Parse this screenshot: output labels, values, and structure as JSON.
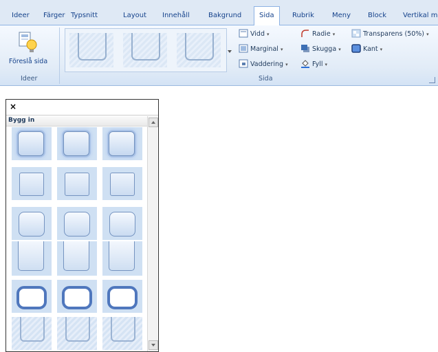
{
  "ribbon": {
    "tabs": [
      {
        "label": "Ideer"
      },
      {
        "label": "Färger"
      },
      {
        "label": "Typsnitt"
      },
      {
        "label": "Layout"
      },
      {
        "label": "Innehåll"
      },
      {
        "label": "Bakgrund"
      },
      {
        "label": "Sida",
        "active": true
      },
      {
        "label": "Rubrik"
      },
      {
        "label": "Meny"
      },
      {
        "label": "Block"
      },
      {
        "label": "Vertikal m"
      }
    ],
    "suggest_button": {
      "label": "Föreslå sida",
      "icon": "lightbulb-page-icon"
    },
    "groups": {
      "ideer_label": "Ideer",
      "sida_label": "Sida"
    },
    "sida_items": {
      "vidd": "Vidd",
      "marginal": "Marginal",
      "vaddering": "Vaddering",
      "radie": "Radie",
      "skugga": "Skugga",
      "fyll": "Fyll",
      "transparens": "Transparens (50%)",
      "kant": "Kant"
    }
  },
  "pane": {
    "close_symbol": "×",
    "section_title": "Bygg in"
  },
  "colors": {
    "accent": "#2b579a",
    "tab_bg": "#dfe9f5",
    "panel": "#e2ecf7",
    "thumb_bg": "#cfe0f3",
    "kant": "#2b6fd6"
  }
}
